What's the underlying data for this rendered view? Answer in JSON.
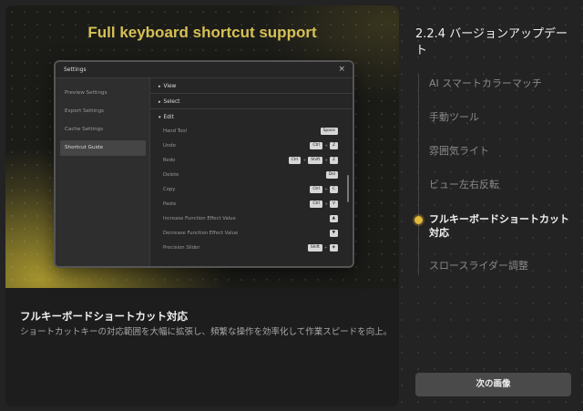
{
  "hero": {
    "title": "Full keyboard shortcut support"
  },
  "mock_window": {
    "title": "Settings",
    "close_glyph": "×",
    "sidebar": [
      "Preview Settings",
      "Export Settings",
      "Cache Settings",
      "Shortcut Guide"
    ],
    "active_sidebar": "Shortcut Guide",
    "sections": [
      {
        "label": "View",
        "arrow": "▸"
      },
      {
        "label": "Select",
        "arrow": "▸"
      },
      {
        "label": "Edit",
        "arrow": "▾"
      }
    ],
    "shortcuts": [
      {
        "name": "Hand Tool",
        "keys": [
          "Space"
        ]
      },
      {
        "name": "Undo",
        "keys": [
          "Ctrl",
          "Z"
        ]
      },
      {
        "name": "Redo",
        "keys": [
          "Ctrl",
          "Shift",
          "Z"
        ]
      },
      {
        "name": "Delete",
        "keys": [
          "Del"
        ]
      },
      {
        "name": "Copy",
        "keys": [
          "Ctrl",
          "C"
        ]
      },
      {
        "name": "Paste",
        "keys": [
          "Ctrl",
          "V"
        ]
      },
      {
        "name": "Increase Function Effect Value",
        "keys": [
          "▲"
        ]
      },
      {
        "name": "Decrease Function Effect Value",
        "keys": [
          "▼"
        ]
      },
      {
        "name": "Precision Slider",
        "keys": [
          "Shift",
          "◈"
        ]
      }
    ]
  },
  "caption": {
    "title": "フルキーボードショートカット対応",
    "description": "ショートカットキーの対応範囲を大幅に拡張し、頻繁な操作を効率化して作業スピードを向上。"
  },
  "release": {
    "version_title": "2.2.4 バージョンアップデート",
    "features": [
      "AI スマートカラーマッチ",
      "手動ツール",
      "雰囲気ライト",
      "ビュー左右反転",
      "フルキーボードショートカット対応",
      "スロースライダー調整"
    ],
    "active_index": 4
  },
  "buttons": {
    "next": "次の画像"
  },
  "colors": {
    "accent": "#e2b93b",
    "hero_title": "#d6c055"
  }
}
